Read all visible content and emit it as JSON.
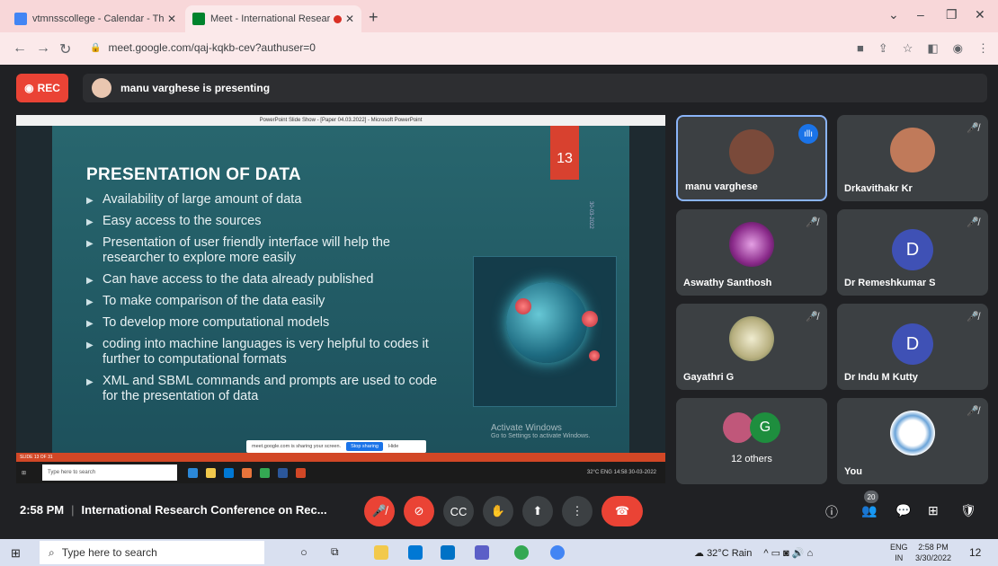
{
  "browser": {
    "tabs": [
      {
        "title": "vtmnsscollege - Calendar - Thurs",
        "active": false
      },
      {
        "title": "Meet - International Researc",
        "active": true
      }
    ],
    "url": "meet.google.com/qaj-kqkb-cev?authuser=0",
    "new_tab": "+",
    "close": "✕"
  },
  "meet": {
    "rec_label": "REC",
    "presenting_text": "manu varghese is presenting",
    "time": "2:58 PM",
    "separator": "|",
    "meeting_title": "International Research Conference on Rec...",
    "participant_count": "20"
  },
  "slide": {
    "window_title": "PowerPoint Slide Show - [Paper 04.03.2022] - Microsoft PowerPoint",
    "title": "PRESENTATION OF DATA",
    "number": "13",
    "date": "30-03-2022",
    "bullets": [
      "Availability of large amount of data",
      "Easy access to the sources",
      "Presentation of user friendly interface will help the researcher to explore more easily",
      "Can have access to the data already published",
      "To make comparison of the data easily",
      "To develop more computational models",
      "coding into machine languages is very helpful to codes it further to computational formats",
      "XML and SBML commands and prompts are used to code for the presentation of data"
    ],
    "activate_title": "Activate Windows",
    "activate_sub": "Go to Settings to activate Windows.",
    "share_text": "meet.google.com is sharing your screen.",
    "stop_sharing": "Stop sharing",
    "hide": "Hide",
    "status": "SLIDE 13 OF 31",
    "inner_search": "Type here to search",
    "inner_tray": "32°C  ENG  14:58  30-03-2022"
  },
  "participants": [
    {
      "name": "manu varghese",
      "type": "photo",
      "color": "#7a4a3a",
      "speaking": true
    },
    {
      "name": "Drkavithakr Kr",
      "type": "photo",
      "color": "#c07a5a",
      "muted": true
    },
    {
      "name": "Aswathy Santhosh",
      "type": "photo",
      "color": "#b04ab0",
      "muted": true
    },
    {
      "name": "Dr Remeshkumar S",
      "type": "letter",
      "letter": "D",
      "muted": true
    },
    {
      "name": "Gayathri G",
      "type": "photo",
      "color": "#d8d0a0",
      "muted": true
    },
    {
      "name": "Dr Indu M Kutty",
      "type": "letter",
      "letter": "D",
      "muted": true
    },
    {
      "name": "12 others",
      "type": "others",
      "letter": "G"
    },
    {
      "name": "You",
      "type": "logo",
      "muted": true
    }
  ],
  "taskbar": {
    "search": "Type here to search",
    "weather": "32°C Rain",
    "lang1": "ENG",
    "lang2": "IN",
    "time": "2:58 PM",
    "date": "3/30/2022",
    "notif_count": "12"
  },
  "colors": {
    "rec_red": "#ea4335",
    "accent_blue": "#1a73e8",
    "slide_number_bg": "#d8412f"
  }
}
